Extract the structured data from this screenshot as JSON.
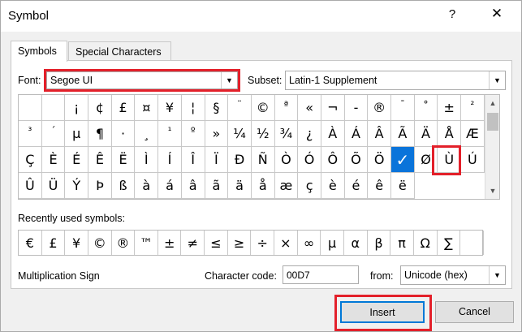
{
  "window": {
    "title": "Symbol",
    "help": "?",
    "close": "✕"
  },
  "tabs": [
    {
      "label": "Symbols"
    },
    {
      "label": "Special Characters"
    }
  ],
  "font": {
    "label": "Font:",
    "value": "Segoe UI"
  },
  "subset": {
    "label": "Subset:",
    "value": "Latin-1 Supplement"
  },
  "grid": [
    " ",
    "¡",
    "¢",
    "£",
    "¤",
    "¥",
    "¦",
    "§",
    "¨",
    "©",
    "ª",
    "«",
    "¬",
    "-",
    "®",
    "¯",
    "°",
    "±",
    "²",
    "³",
    "´",
    "µ",
    "¶",
    "·",
    "¸",
    "¹",
    "º",
    "»",
    "¼",
    "½",
    "¾",
    "¿",
    "À",
    "Á",
    "Â",
    "Ã",
    "Ä",
    "Å",
    "Æ",
    "Ç",
    "È",
    "É",
    "Ê",
    "Ë",
    "Ì",
    "Í",
    "Î",
    "Ï",
    "Ð",
    "Ñ",
    "Ò",
    "Ó",
    "Ô",
    "Õ",
    "Ö",
    "✓",
    "Ø",
    "Ù",
    "Ú",
    "Û",
    "Ü",
    "Ý",
    "Þ",
    "ß",
    "à",
    "á",
    "â",
    "ã",
    "ä",
    "å",
    "æ",
    "ç",
    "è",
    "é",
    "ê",
    "ë"
  ],
  "selected_index": 55,
  "recent": {
    "label": "Recently used symbols:",
    "symbols": [
      "€",
      "£",
      "¥",
      "©",
      "®",
      "™",
      "±",
      "≠",
      "≤",
      "≥",
      "÷",
      "×",
      "∞",
      "µ",
      "α",
      "β",
      "π",
      "Ω",
      "∑",
      ""
    ]
  },
  "char_name": "Multiplication Sign",
  "char_code": {
    "label": "Character code:",
    "value": "00D7"
  },
  "from": {
    "label": "from:",
    "value": "Unicode (hex)"
  },
  "buttons": {
    "insert": "Insert",
    "cancel": "Cancel"
  },
  "colors": {
    "highlight": "#e3202a",
    "selection": "#0a74da"
  }
}
